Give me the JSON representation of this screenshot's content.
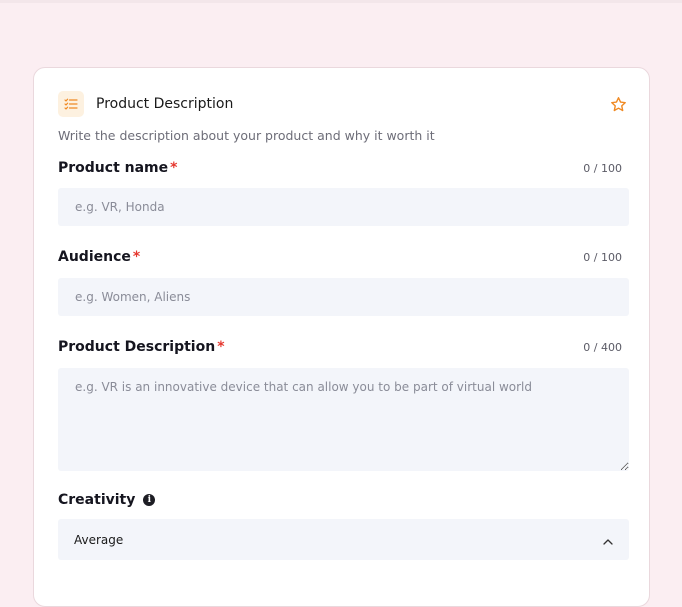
{
  "card": {
    "title": "Product Description",
    "subtitle": "Write the description about your product and why it worth it"
  },
  "fields": {
    "product_name": {
      "label": "Product name",
      "required_mark": "*",
      "counter": "0 / 100",
      "placeholder": "e.g. VR, Honda"
    },
    "audience": {
      "label": "Audience",
      "required_mark": "*",
      "counter": "0 / 100",
      "placeholder": "e.g. Women, Aliens"
    },
    "product_description": {
      "label": "Product Description",
      "required_mark": "*",
      "counter": "0 / 400",
      "placeholder": "e.g. VR is an innovative device that can allow you to be part of virtual world"
    },
    "creativity": {
      "label": "Creativity",
      "info_glyph": "i",
      "selected": "Average"
    }
  },
  "icons": {
    "title_icon": "list-check-icon",
    "favorite": "star-icon",
    "info": "info-icon",
    "dropdown": "chevron-up-icon"
  },
  "colors": {
    "page_background": "#fbeef2",
    "card_background": "#ffffff",
    "field_background": "#f3f5fa",
    "accent_orange": "#f08a24",
    "required_red": "#e5372e",
    "icon_tile": "#fdf1e0"
  }
}
